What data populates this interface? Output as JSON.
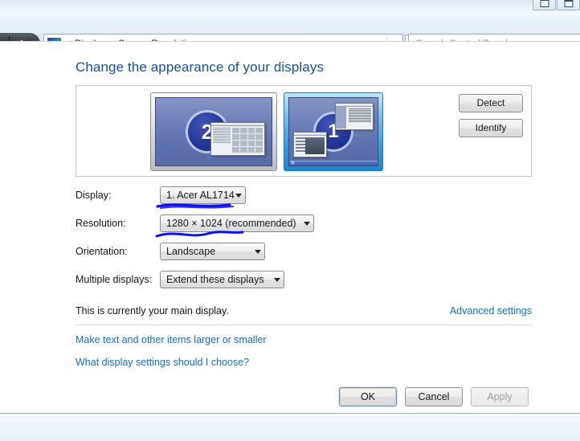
{
  "window": {
    "controls": [
      {
        "name": "minimize",
        "glyph": "minimize-icon"
      },
      {
        "name": "maximize",
        "glyph": "maximize-icon"
      }
    ]
  },
  "nav": {
    "back_glyph": "◀",
    "forward_glyph": "▶",
    "breadcrumb_icon": "display-monitor-icon",
    "overflow_chevron": "«",
    "crumbs": [
      "Display",
      "Screen Resolution"
    ],
    "separator": "▸",
    "dropdown_icon": "chevron-down-icon",
    "go_icon": "↷"
  },
  "search": {
    "placeholder": "Search Control Panel"
  },
  "page": {
    "title": "Change the appearance of your displays"
  },
  "preview": {
    "monitors": [
      {
        "number": "2",
        "selected": false,
        "label": "monitor-2"
      },
      {
        "number": "1",
        "selected": true,
        "label": "monitor-1"
      }
    ],
    "buttons": [
      {
        "label": "Detect",
        "name": "detect-button"
      },
      {
        "label": "Identify",
        "name": "identify-button"
      }
    ]
  },
  "form": {
    "rows": [
      {
        "label": "Display:",
        "value": "1. Acer AL1714",
        "name": "display"
      },
      {
        "label": "Resolution:",
        "value": "1280 × 1024 (recommended)",
        "name": "resolution"
      },
      {
        "label": "Orientation:",
        "value": "Landscape",
        "name": "orientation"
      },
      {
        "label": "Multiple displays:",
        "value": "Extend these displays",
        "name": "multiple"
      }
    ]
  },
  "status": {
    "main_display_text": "This is currently your main display.",
    "advanced_settings_link": "Advanced settings"
  },
  "links": [
    "Make text and other items larger or smaller",
    "What display settings should I choose?"
  ],
  "footer": {
    "ok": "OK",
    "cancel": "Cancel",
    "apply": "Apply"
  },
  "annotations": {
    "color": "#1010f0",
    "marks": [
      {
        "name": "underline-display-dropdown",
        "target": "display"
      },
      {
        "name": "squiggle-resolution-dropdown",
        "target": "resolution"
      }
    ]
  },
  "colors": {
    "heading_blue": "#1a4fa0",
    "link_blue": "#1a6bc4",
    "selection_blue": "#2f9be3",
    "screen_blue": "#6f7fba",
    "badge_blue": "#26379b"
  }
}
